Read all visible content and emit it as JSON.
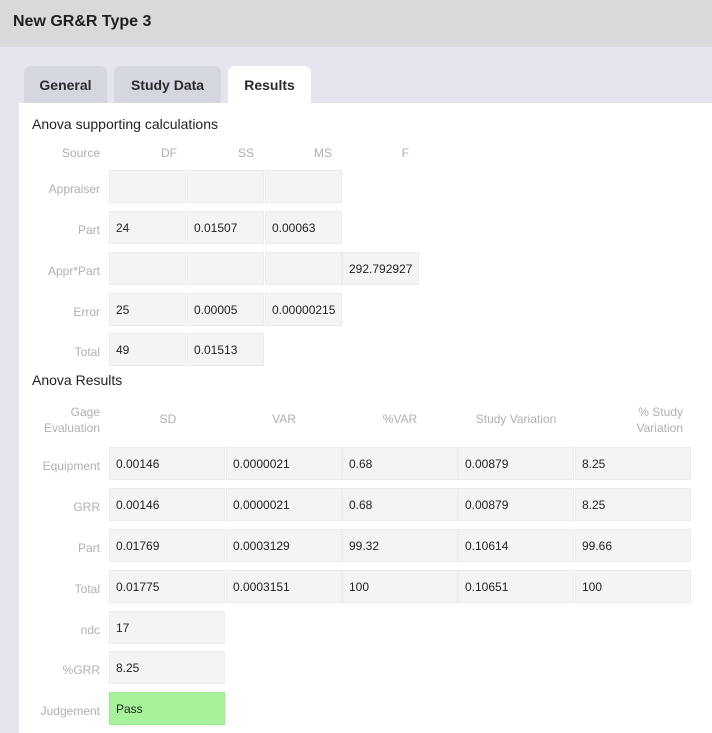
{
  "window": {
    "title": "New GR&R Type 3"
  },
  "tabs": [
    {
      "label": "General",
      "active": false
    },
    {
      "label": "Study Data",
      "active": false
    },
    {
      "label": "Results",
      "active": true
    }
  ],
  "anova_calc": {
    "title": "Anova supporting calculations",
    "headers": [
      "Source",
      "DF",
      "SS",
      "MS",
      "F"
    ],
    "rows": [
      {
        "label": "Appraiser",
        "df": "",
        "ss": "",
        "ms": "",
        "f": ""
      },
      {
        "label": "Part",
        "df": "24",
        "ss": "0.01507",
        "ms": "0.00063",
        "f": ""
      },
      {
        "label": "Appr*Part",
        "df": "",
        "ss": "",
        "ms": "",
        "f": "292.792927"
      },
      {
        "label": "Error",
        "df": "25",
        "ss": "0.00005",
        "ms": "0.00000215",
        "f": ""
      },
      {
        "label": "Total",
        "df": "49",
        "ss": "0.01513",
        "ms": "",
        "f": ""
      }
    ]
  },
  "anova_results": {
    "title": "Anova Results",
    "headers": [
      "Gage Evaluation",
      "SD",
      "VAR",
      "%VAR",
      "Study Variation",
      "% Study Variation"
    ],
    "rows": [
      {
        "label": "Equipment",
        "sd": "0.00146",
        "var": "0.0000021",
        "pvar": "0.68",
        "sv": "0.00879",
        "psv": "8.25"
      },
      {
        "label": "GRR",
        "sd": "0.00146",
        "var": "0.0000021",
        "pvar": "0.68",
        "sv": "0.00879",
        "psv": "8.25"
      },
      {
        "label": "Part",
        "sd": "0.01769",
        "var": "0.0003129",
        "pvar": "99.32",
        "sv": "0.10614",
        "psv": "99.66"
      },
      {
        "label": "Total",
        "sd": "0.01775",
        "var": "0.0003151",
        "pvar": "100",
        "sv": "0.10651",
        "psv": "100"
      }
    ],
    "ndc": {
      "label": "ndc",
      "value": "17"
    },
    "grr": {
      "label": "%GRR",
      "value": "8.25"
    },
    "judgement": {
      "label": "Judgement",
      "value": "Pass",
      "color": "#a7f29b"
    }
  }
}
